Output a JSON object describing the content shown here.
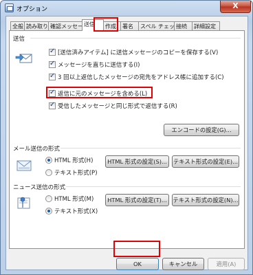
{
  "window": {
    "title": "オプション",
    "close_label": "X"
  },
  "tabs": [
    {
      "label": "全般",
      "active": false
    },
    {
      "label": "読み取り",
      "active": false
    },
    {
      "label": "確認メッセージ",
      "active": false
    },
    {
      "label": "送信",
      "active": true
    },
    {
      "label": "作成",
      "active": false
    },
    {
      "label": "署名",
      "active": false
    },
    {
      "label": "スペル チェック",
      "active": false
    },
    {
      "label": "接続",
      "active": false
    },
    {
      "label": "詳細設定",
      "active": false
    }
  ],
  "send": {
    "heading": "送信",
    "options": [
      {
        "label": "[送信済みアイテム] に送信メッセージのコピーを保存する(V)",
        "checked": true
      },
      {
        "label": "メッセージを直ちに送信する(I)",
        "checked": true
      },
      {
        "label": "3 回以上返信したメッセージの宛先をアドレス帳に追加する(C)",
        "checked": true
      },
      {
        "label": "返信に元のメッセージを含める(L)",
        "checked": true
      },
      {
        "label": "受信したメッセージと同じ形式で返信する(R)",
        "checked": true
      }
    ],
    "encode_button": "エンコードの設定(G)..."
  },
  "mail_format": {
    "heading": "メール送信の形式",
    "html_option": "HTML 形式(H)",
    "text_option": "テキスト形式(P)",
    "selected": "html",
    "html_settings_button": "HTML 形式の設定(S)...",
    "text_settings_button": "テキスト形式の設定(E)..."
  },
  "news_format": {
    "heading": "ニュース送信の形式",
    "html_option": "HTML 形式(M)",
    "text_option": "テキスト形式(X)",
    "selected": "text",
    "html_settings_button": "HTML 形式の設定(T)...",
    "text_settings_button": "テキスト形式の設定(N)..."
  },
  "footer": {
    "ok": "OK",
    "cancel": "キャンセル",
    "apply": "適用(A)"
  },
  "colors": {
    "highlight": "#e30000",
    "accent": "#1d5a9e"
  }
}
